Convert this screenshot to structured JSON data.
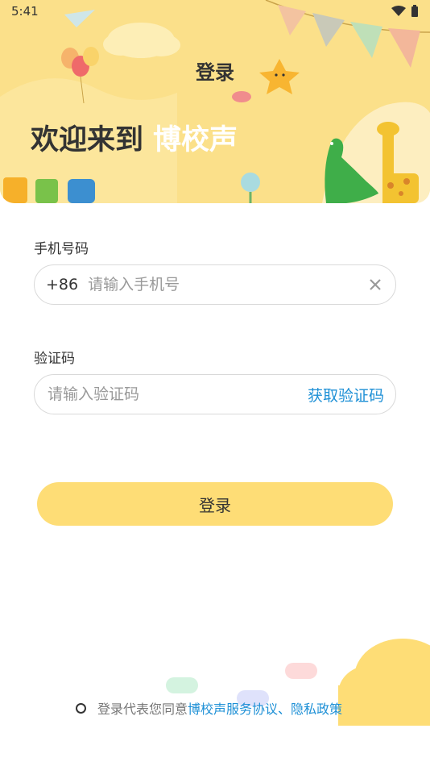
{
  "status_bar": {
    "time": "5:41"
  },
  "header": {
    "title": "登录",
    "welcome_text": "欢迎来到",
    "brand_name": "博校声"
  },
  "phone": {
    "label": "手机号码",
    "prefix": "+86",
    "placeholder": "请输入手机号"
  },
  "code": {
    "label": "验证码",
    "placeholder": "请输入验证码",
    "get_code_label": "获取验证码"
  },
  "login_button_label": "登录",
  "agreement": {
    "prefix": "登录代表您同意",
    "service_link": "博校声服务协议",
    "separator": "、",
    "privacy_link": "隐私政策"
  },
  "colors": {
    "banner": "#fbe08a",
    "button": "#fedd76",
    "link": "#1e90d6"
  }
}
